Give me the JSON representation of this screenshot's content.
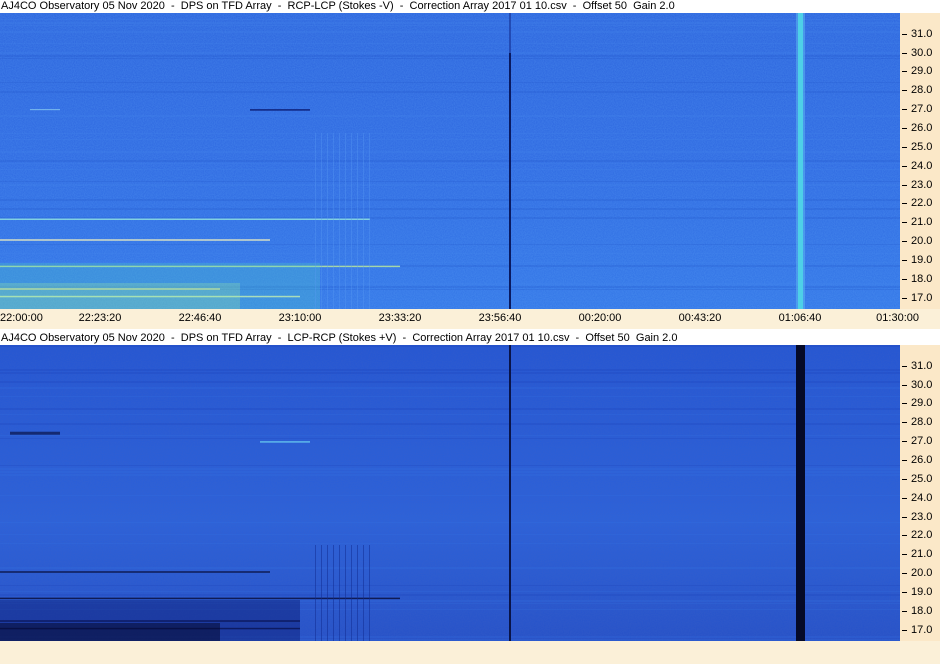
{
  "panels": [
    {
      "title": "AJ4CO Observatory 05 Nov 2020  -  DPS on TFD Array  -  RCP-LCP (Stokes -V)  -  Correction Array 2017 01 10.csv  -  Offset 50  Gain 2.0",
      "y_ticks": [
        "31.0",
        "30.0",
        "29.0",
        "28.0",
        "27.0",
        "26.0",
        "25.0",
        "24.0",
        "23.0",
        "22.0",
        "21.0",
        "20.0",
        "19.0",
        "18.0",
        "17.0"
      ]
    },
    {
      "title": "AJ4CO Observatory 05 Nov 2020  -  DPS on TFD Array  -  LCP-RCP (Stokes +V)  -  Correction Array 2017 01 10.csv  -  Offset 50  Gain 2.0",
      "y_ticks": [
        "31.0",
        "30.0",
        "29.0",
        "28.0",
        "27.0",
        "26.0",
        "25.0",
        "24.0",
        "23.0",
        "22.0",
        "21.0",
        "20.0",
        "19.0",
        "18.0",
        "17.0"
      ]
    }
  ],
  "chart_data": [
    {
      "type": "heatmap",
      "title": "AJ4CO Observatory 05 Nov 2020  -  DPS on TFD Array  -  RCP-LCP (Stokes -V)  -  Correction Array 2017 01 10.csv  -  Offset 50  Gain 2.0",
      "x_ticks": [
        "22:00:00",
        "22:23:20",
        "22:46:40",
        "23:10:00",
        "23:33:20",
        "23:56:40",
        "00:20:00",
        "00:43:20",
        "01:06:40",
        "01:30:00"
      ],
      "x_range": [
        "22:00:00",
        "01:30:00"
      ],
      "y_ticks": [
        31.0,
        30.0,
        29.0,
        28.0,
        27.0,
        26.0,
        25.0,
        24.0,
        23.0,
        22.0,
        21.0,
        20.0,
        19.0,
        18.0,
        17.0
      ],
      "y_range": [
        16.4,
        32.1
      ],
      "colormap": [
        "#1a3fc0",
        "#2d6ae8",
        "#3fa0f0",
        "#6ee0c0",
        "#e8f0a0"
      ],
      "features": {
        "dark_vertical_line_time": "23:59:00",
        "bright_vertical_band_time": "01:06:40",
        "bright_horizontal_lines_mhz": [
          21.2,
          20.1,
          18.7,
          17.5,
          17.1
        ]
      }
    },
    {
      "type": "heatmap",
      "title": "AJ4CO Observatory 05 Nov 2020  -  DPS on TFD Array  -  LCP-RCP (Stokes +V)  -  Correction Array 2017 01 10.csv  -  Offset 50  Gain 2.0",
      "x_range": [
        "22:00:00",
        "01:30:00"
      ],
      "y_ticks": [
        31.0,
        30.0,
        29.0,
        28.0,
        27.0,
        26.0,
        25.0,
        24.0,
        23.0,
        22.0,
        21.0,
        20.0,
        19.0,
        18.0,
        17.0
      ],
      "y_range": [
        16.4,
        32.1
      ],
      "colormap": [
        "#050a30",
        "#1a3fc0",
        "#2d6ae8",
        "#3fa0f0"
      ],
      "features": {
        "dark_vertical_line_time": "23:59:00",
        "dark_vertical_band_time": "01:06:40",
        "dark_horizontal_lines_mhz": [
          20.1,
          18.7,
          17.5,
          17.1
        ]
      }
    }
  ],
  "x_axis": {
    "ticks": [
      "22:00:00",
      "22:23:20",
      "22:46:40",
      "23:10:00",
      "23:33:20",
      "23:56:40",
      "00:20:00",
      "00:43:20",
      "01:06:40",
      "01:30:00"
    ]
  }
}
